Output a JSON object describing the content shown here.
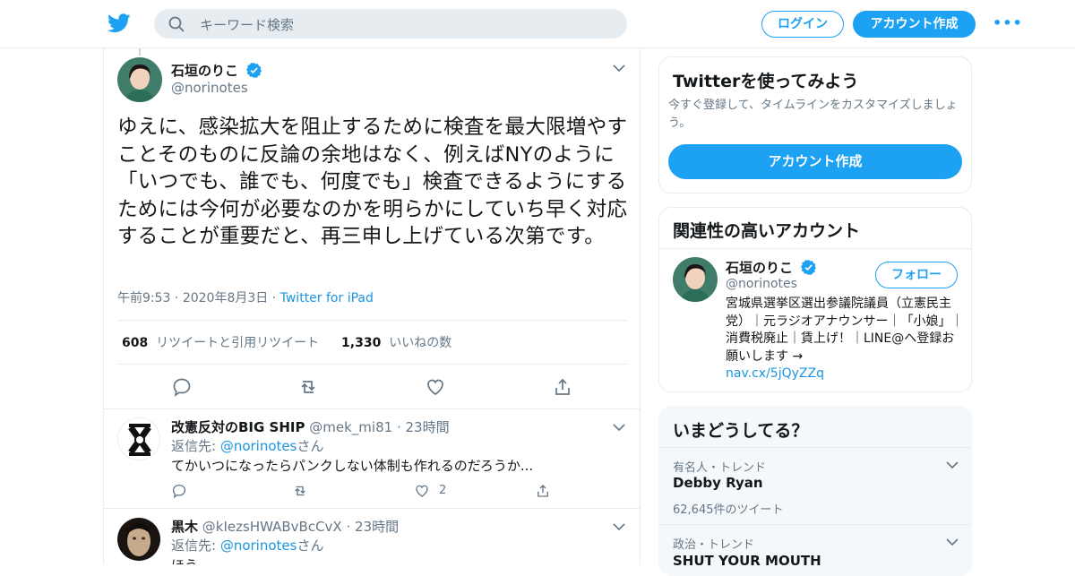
{
  "header": {
    "search_placeholder": "キーワード検索",
    "login_label": "ログイン",
    "signup_label": "アカウント作成",
    "more_label": "•••"
  },
  "tweet": {
    "author_name": "石垣のりこ",
    "author_handle": "@norinotes",
    "text": "ゆえに、感染拡大を阻止するために検査を最大限増やすことそのものに反論の余地はなく、例えばNYのように「いつでも、誰でも、何度でも」検査できるようにするためには今何が必要なのかを明らかにしていち早く対応することが重要だと、再三申し上げている次第です。",
    "time": "午前9:53",
    "date": "2020年8月3日",
    "source": "Twitter for iPad",
    "retweet_count": "608",
    "retweet_label": "リツイートと引用リツイート",
    "like_count": "1,330",
    "like_label": "いいねの数"
  },
  "replies": [
    {
      "name": "改憲反対のBIG SHIP",
      "handle": "@mek_mi81",
      "time": "23時間",
      "reply_to_prefix": "返信先: ",
      "reply_to_handle": "@norinotes",
      "reply_to_suffix": "さん",
      "text": "てかいつになったらパンクしない体制も作れるのだろうか...",
      "like_count": "2"
    },
    {
      "name": "黒木",
      "handle": "@kIezsHWABvBcCvX",
      "time": "23時間",
      "reply_to_prefix": "返信先: ",
      "reply_to_handle": "@norinotes",
      "reply_to_suffix": "さん",
      "text": "ほう"
    }
  ],
  "sidebar": {
    "signup_card": {
      "title": "Twitterを使ってみよう",
      "description": "今すぐ登録して、タイムラインをカスタマイズしましょう。",
      "button_label": "アカウント作成"
    },
    "related_card": {
      "title": "関連性の高いアカウント",
      "name": "石垣のりこ",
      "handle": "@norinotes",
      "follow_label": "フォロー",
      "bio": "宮城県選挙区選出参議院議員（立憲民主党）｜元ラジオアナウンサー｜「小娘」｜消費税廃止｜賃上げ！｜LINE@へ登録お願いします →",
      "bio_link": "nav.cx/5jQyZZq"
    },
    "trends_card": {
      "title": "いまどうしてる？",
      "items": [
        {
          "meta": "有名人・トレンド",
          "name": "Debby Ryan",
          "count": "62,645件のツイート"
        },
        {
          "meta": "政治・トレンド",
          "name": "SHUT YOUR MOUTH"
        }
      ]
    }
  },
  "colors": {
    "accent": "#1da1f2",
    "link": "#1b95e0",
    "text": "#14171a",
    "muted": "#657786",
    "border": "#e6ecf0"
  }
}
